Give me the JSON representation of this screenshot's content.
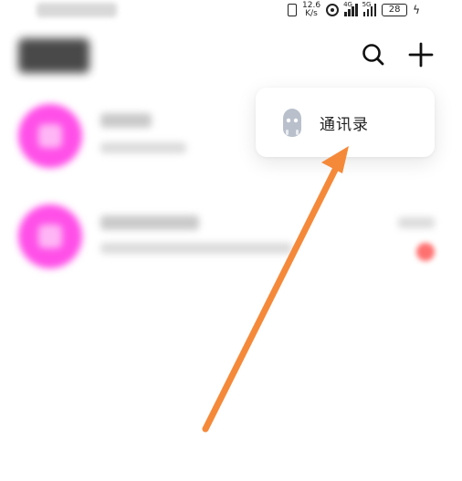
{
  "status_bar": {
    "net_speed_value": "12.6",
    "net_speed_unit": "K/s",
    "signal_1_label": "4G",
    "signal_2_label": "5G",
    "battery": "28"
  },
  "popup_menu": {
    "contacts_label": "通讯录"
  },
  "colors": {
    "accent_avatar": "#ff4fe8",
    "arrow": "#f5893a",
    "badge": "#ff4d4d"
  },
  "icons": {
    "search": "search-icon",
    "add": "plus-icon",
    "contacts": "contacts-icon"
  }
}
